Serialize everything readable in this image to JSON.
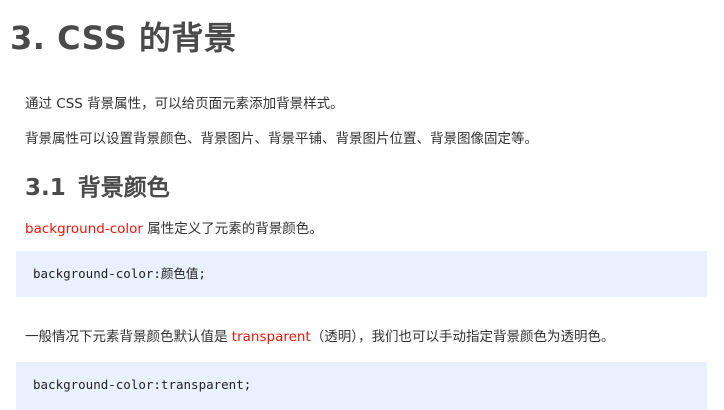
{
  "heading": "3. CSS 的背景",
  "intro": {
    "line1": "通过 CSS 背景属性，可以给页面元素添加背景样式。",
    "line2": "背景属性可以设置背景颜色、背景图片、背景平铺、背景图片位置、背景图像固定等。"
  },
  "section": {
    "number": "3.1",
    "title": "背景颜色"
  },
  "desc": {
    "keyword": "background-color",
    "text": " 属性定义了元素的背景颜色。"
  },
  "code1": "background-color:颜色值;",
  "note": {
    "before": "一般情况下元素背景颜色默认值是 ",
    "keyword": "transparent",
    "after": "（透明），我们也可以手动指定背景颜色为透明色。"
  },
  "code2": "background-color:transparent;",
  "colors": {
    "keyword_red": "#e8170e",
    "code_bg": "#e8f1fd",
    "heading_gray": "#4a4a4a"
  }
}
